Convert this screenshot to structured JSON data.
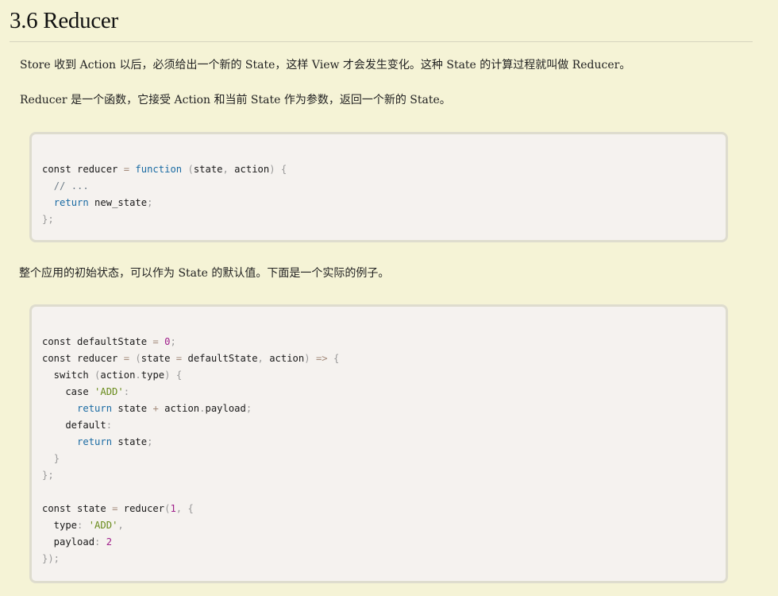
{
  "section": {
    "title": "3.6 Reducer"
  },
  "paragraphs": {
    "p1": "Store 收到 Action 以后，必须给出一个新的 State，这样 View 才会发生变化。这种 State 的计算过程就叫做 Reducer。",
    "p2": "Reducer 是一个函数，它接受 Action 和当前 State 作为参数，返回一个新的 State。",
    "p3": "整个应用的初始状态，可以作为 State 的默认值。下面是一个实际的例子。"
  },
  "code_blocks": [
    {
      "lines": [
        [
          [
            "plain",
            "const reducer "
          ],
          [
            "op",
            "="
          ],
          [
            "plain",
            " "
          ],
          [
            "kw",
            "function"
          ],
          [
            "plain",
            " "
          ],
          [
            "punc",
            "("
          ],
          [
            "plain",
            "state"
          ],
          [
            "punc",
            ","
          ],
          [
            "plain",
            " action"
          ],
          [
            "punc",
            ")"
          ],
          [
            "plain",
            " "
          ],
          [
            "punc",
            "{"
          ]
        ],
        [
          [
            "plain",
            "  "
          ],
          [
            "cmt",
            "// ..."
          ]
        ],
        [
          [
            "plain",
            "  "
          ],
          [
            "kw",
            "return"
          ],
          [
            "plain",
            " new_state"
          ],
          [
            "punc",
            ";"
          ]
        ],
        [
          [
            "punc",
            "};"
          ]
        ]
      ]
    },
    {
      "lines": [
        [
          [
            "plain",
            "const defaultState "
          ],
          [
            "op",
            "="
          ],
          [
            "plain",
            " "
          ],
          [
            "num",
            "0"
          ],
          [
            "punc",
            ";"
          ]
        ],
        [
          [
            "plain",
            "const reducer "
          ],
          [
            "op",
            "="
          ],
          [
            "plain",
            " "
          ],
          [
            "punc",
            "("
          ],
          [
            "plain",
            "state "
          ],
          [
            "op",
            "="
          ],
          [
            "plain",
            " defaultState"
          ],
          [
            "punc",
            ","
          ],
          [
            "plain",
            " action"
          ],
          [
            "punc",
            ")"
          ],
          [
            "plain",
            " "
          ],
          [
            "op",
            "=>"
          ],
          [
            "plain",
            " "
          ],
          [
            "punc",
            "{"
          ]
        ],
        [
          [
            "plain",
            "  switch "
          ],
          [
            "punc",
            "("
          ],
          [
            "plain",
            "action"
          ],
          [
            "punc",
            "."
          ],
          [
            "plain",
            "type"
          ],
          [
            "punc",
            ")"
          ],
          [
            "plain",
            " "
          ],
          [
            "punc",
            "{"
          ]
        ],
        [
          [
            "plain",
            "    case "
          ],
          [
            "str",
            "'ADD'"
          ],
          [
            "punc",
            ":"
          ]
        ],
        [
          [
            "plain",
            "      "
          ],
          [
            "kw",
            "return"
          ],
          [
            "plain",
            " state "
          ],
          [
            "op",
            "+"
          ],
          [
            "plain",
            " action"
          ],
          [
            "punc",
            "."
          ],
          [
            "plain",
            "payload"
          ],
          [
            "punc",
            ";"
          ]
        ],
        [
          [
            "plain",
            "    default"
          ],
          [
            "punc",
            ":"
          ]
        ],
        [
          [
            "plain",
            "      "
          ],
          [
            "kw",
            "return"
          ],
          [
            "plain",
            " state"
          ],
          [
            "punc",
            ";"
          ]
        ],
        [
          [
            "plain",
            "  "
          ],
          [
            "punc",
            "}"
          ]
        ],
        [
          [
            "punc",
            "};"
          ]
        ],
        [
          [
            "plain",
            ""
          ]
        ],
        [
          [
            "plain",
            "const state "
          ],
          [
            "op",
            "="
          ],
          [
            "plain",
            " reducer"
          ],
          [
            "punc",
            "("
          ],
          [
            "num",
            "1"
          ],
          [
            "punc",
            ","
          ],
          [
            "plain",
            " "
          ],
          [
            "punc",
            "{"
          ]
        ],
        [
          [
            "plain",
            "  type"
          ],
          [
            "punc",
            ":"
          ],
          [
            "plain",
            " "
          ],
          [
            "str",
            "'ADD'"
          ],
          [
            "punc",
            ","
          ]
        ],
        [
          [
            "plain",
            "  payload"
          ],
          [
            "punc",
            ":"
          ],
          [
            "plain",
            " "
          ],
          [
            "num",
            "2"
          ]
        ],
        [
          [
            "punc",
            "});"
          ]
        ]
      ]
    }
  ]
}
